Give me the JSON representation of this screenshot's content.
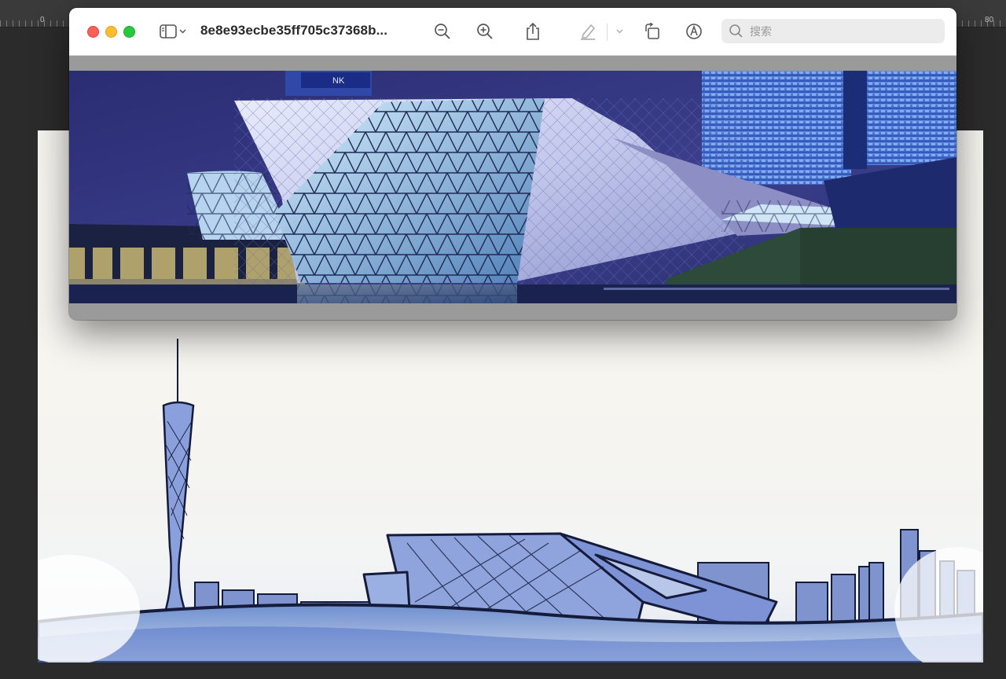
{
  "ruler": {
    "label_zero": "0",
    "label_right": "80"
  },
  "window": {
    "title": "8e8e93ecbe35ff705c37368b...",
    "search": {
      "placeholder": "搜索",
      "value": ""
    },
    "toolbar_icons": [
      "sidebar-icon",
      "chevron-down-icon",
      "zoom-out-icon",
      "zoom-in-icon",
      "share-icon",
      "highlighter-icon",
      "chevron-down-icon",
      "rotate-icon",
      "markup-icon",
      "search-icon"
    ]
  },
  "photo": {
    "signage_text": "NK"
  },
  "colors": {
    "traffic_close": "#fe5f57",
    "traffic_minimize": "#febc2e",
    "traffic_maximize": "#28c840",
    "sky": "#2b2f77",
    "ink_blue": "#4a6fd8"
  }
}
